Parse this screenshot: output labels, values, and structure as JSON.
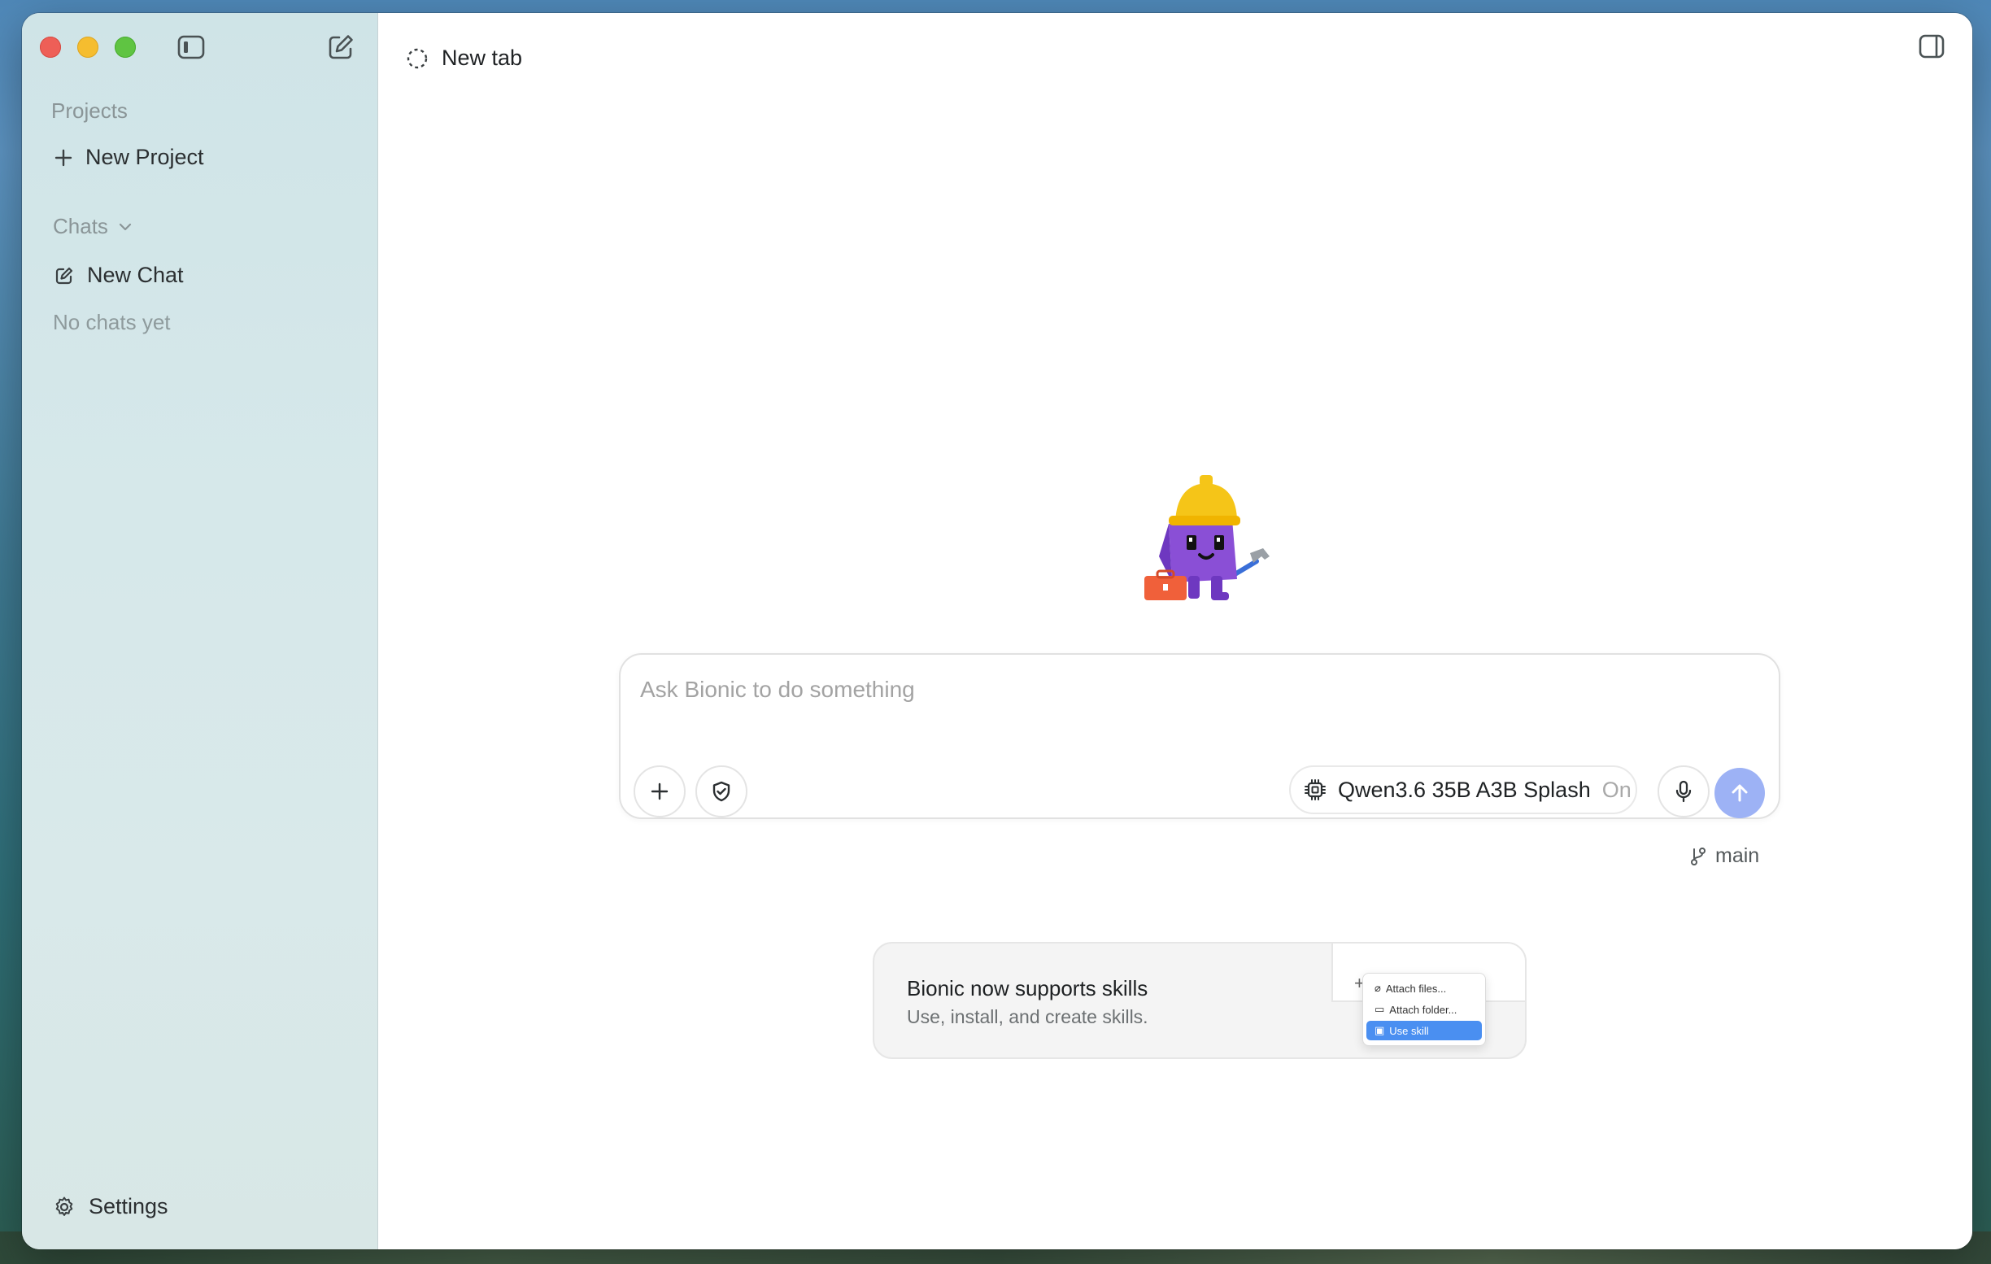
{
  "sidebar": {
    "projects_label": "Projects",
    "new_project_label": "New Project",
    "chats_label": "Chats",
    "new_chat_label": "New Chat",
    "empty_chats_text": "No chats yet",
    "settings_label": "Settings"
  },
  "tab": {
    "title": "New tab"
  },
  "composer": {
    "placeholder": "Ask Bionic to do something",
    "model_name": "Qwen3.6 35B A3B Splash",
    "model_status": "On"
  },
  "branch": {
    "name": "main"
  },
  "skills_card": {
    "title": "Bionic now supports skills",
    "subtitle": "Use, install, and create skills.",
    "menu_items": [
      "Attach files...",
      "Attach folder...",
      "Use skill"
    ]
  },
  "colors": {
    "send_button": "#9db2f5",
    "close": "#ee5f57",
    "minimize": "#f5bd2f",
    "maximize": "#5fc442",
    "mascot_body": "#8a4fd6",
    "mascot_helmet": "#f5c518"
  }
}
